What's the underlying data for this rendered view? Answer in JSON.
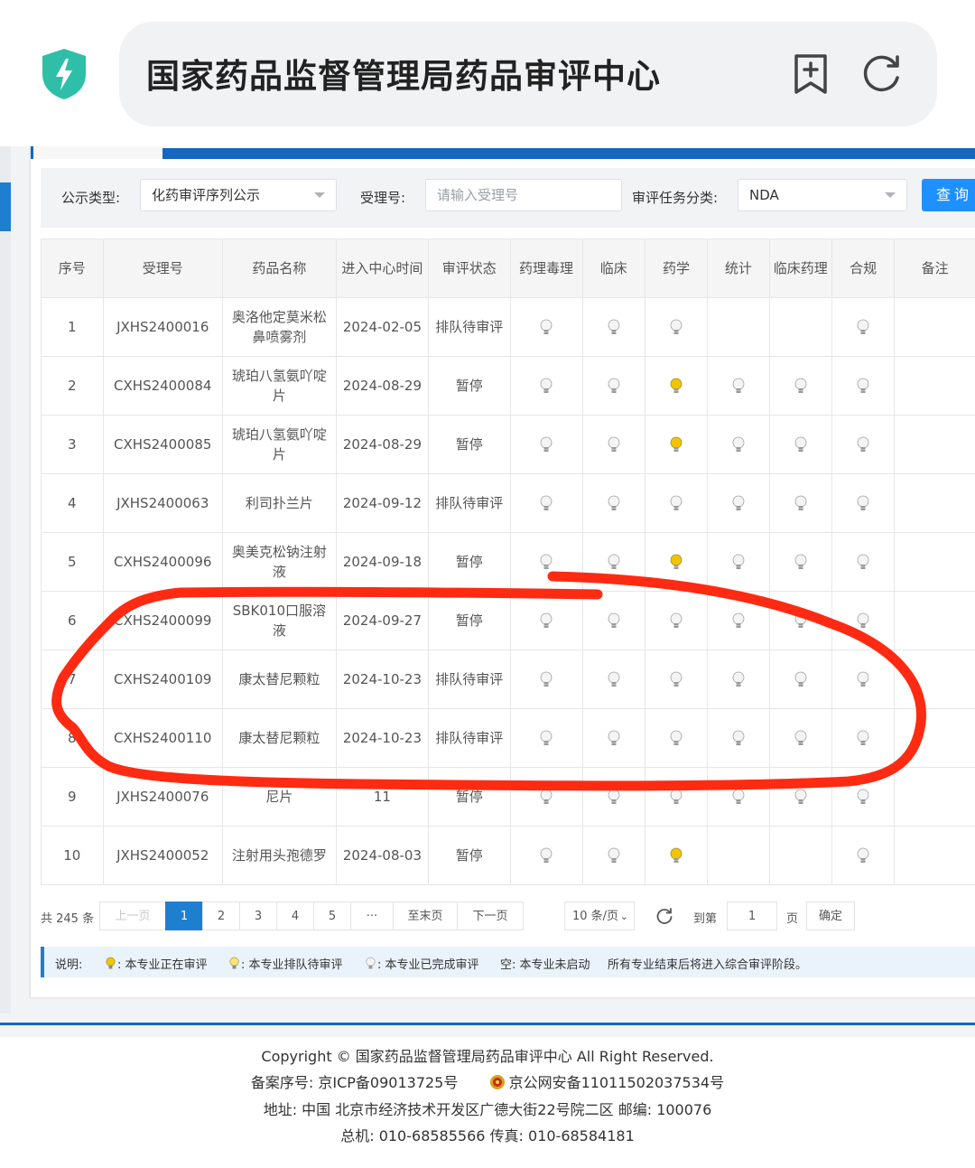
{
  "browser": {
    "site_title": "国家药品监督管理局药品审评中心",
    "icons": [
      "shield-lightning-icon",
      "bookmark-add-icon",
      "refresh-icon"
    ]
  },
  "filters": {
    "type_label": "公示类型:",
    "type_value": "化药审评序列公示",
    "accept_label": "受理号:",
    "accept_placeholder": "请输入受理号",
    "task_label": "审评任务分类:",
    "task_value": "NDA",
    "query_button": "查询"
  },
  "table": {
    "columns": [
      "序号",
      "受理号",
      "药品名称",
      "进入中心时间",
      "审评状态",
      "药理毒理",
      "临床",
      "药学",
      "统计",
      "临床药理",
      "合规",
      "备注"
    ],
    "rows": [
      {
        "no": "1",
        "id": "JXHS2400016",
        "name": "奥洛他定莫米松鼻喷雾剂",
        "date": "2024-02-05",
        "status": "排队待审评",
        "bulbs": [
          "grey",
          "grey",
          "grey",
          "",
          "",
          "grey"
        ]
      },
      {
        "no": "2",
        "id": "CXHS2400084",
        "name": "琥珀八氢氨吖啶片",
        "date": "2024-08-29",
        "status": "暂停",
        "bulbs": [
          "grey",
          "grey",
          "yellow",
          "grey",
          "grey",
          "grey"
        ]
      },
      {
        "no": "3",
        "id": "CXHS2400085",
        "name": "琥珀八氢氨吖啶片",
        "date": "2024-08-29",
        "status": "暂停",
        "bulbs": [
          "grey",
          "grey",
          "yellow",
          "grey",
          "grey",
          "grey"
        ]
      },
      {
        "no": "4",
        "id": "JXHS2400063",
        "name": "利司扑兰片",
        "date": "2024-09-12",
        "status": "排队待审评",
        "bulbs": [
          "grey",
          "grey",
          "grey",
          "grey",
          "grey",
          "grey"
        ]
      },
      {
        "no": "5",
        "id": "CXHS2400096",
        "name": "奥美克松钠注射液",
        "date": "2024-09-18",
        "status": "暂停",
        "bulbs": [
          "grey",
          "grey",
          "yellow",
          "grey",
          "grey",
          "grey"
        ]
      },
      {
        "no": "6",
        "id": "CXHS2400099",
        "name": "SBK010口服溶液",
        "date": "2024-09-27",
        "status": "暂停",
        "bulbs": [
          "grey",
          "grey",
          "grey",
          "grey",
          "grey",
          "grey"
        ]
      },
      {
        "no": "7",
        "id": "CXHS2400109",
        "name": "康太替尼颗粒",
        "date": "2024-10-23",
        "status": "排队待审评",
        "bulbs": [
          "grey",
          "grey",
          "grey",
          "grey",
          "grey",
          "grey"
        ]
      },
      {
        "no": "8",
        "id": "CXHS2400110",
        "name": "康太替尼颗粒",
        "date": "2024-10-23",
        "status": "排队待审评",
        "bulbs": [
          "grey",
          "grey",
          "grey",
          "grey",
          "grey",
          "grey"
        ]
      },
      {
        "no": "9",
        "id": "JXHS2400076",
        "name": "尼片",
        "date": "11",
        "status": "暂停",
        "bulbs": [
          "grey",
          "grey",
          "grey",
          "grey",
          "grey",
          "grey"
        ]
      },
      {
        "no": "10",
        "id": "JXHS2400052",
        "name": "注射用头孢德罗",
        "date": "2024-08-03",
        "status": "暂停",
        "bulbs": [
          "grey",
          "grey",
          "yellow",
          "",
          "",
          "grey"
        ]
      }
    ]
  },
  "pagination": {
    "total": "共 245 条",
    "prev": "上一页",
    "pages": [
      "1",
      "2",
      "3",
      "4",
      "5",
      "···"
    ],
    "current_page": "1",
    "last": "至末页",
    "next": "下一页",
    "page_size": "10 条/页",
    "goto_label": "到第",
    "goto_value": "1",
    "page_unit": "页",
    "confirm": "确定"
  },
  "legend": {
    "title": "说明:",
    "in_review": ": 本专业正在审评",
    "queued": ": 本专业排队待审评",
    "done": ": 本专业已完成审评",
    "empty": "空: 本专业未启动",
    "note": "所有专业结束后将进入综合审评阶段。"
  },
  "footer": {
    "copyright": "Copyright © 国家药品监督管理局药品审评中心   All Right Reserved.",
    "icp": "备案序号: 京ICP备09013725号",
    "police": "京公网安备11011502037534号",
    "address": "地址: 中国 北京市经济技术开发区广德大街22号院二区     邮编: 100076",
    "phone": "总机: 010-68585566      传真: 010-68584181"
  },
  "colors": {
    "brand_blue": "#1566c0",
    "button_blue": "#1e90ff",
    "bulb_active": "#f2c400",
    "bulb_queued": "#f2c400",
    "bulb_done": "#c8c8c8",
    "annotation_red": "#ff2a12"
  }
}
